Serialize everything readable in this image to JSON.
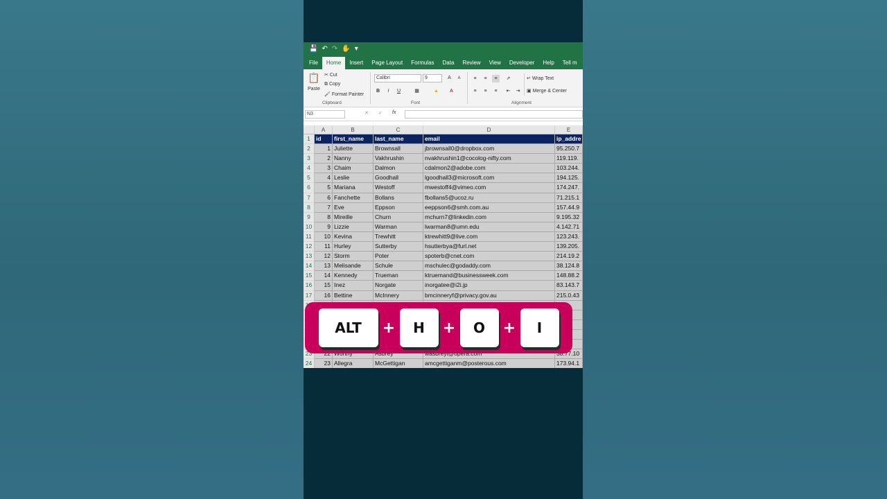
{
  "qat": {
    "save_icon": "save-icon",
    "undo_icon": "undo-icon",
    "redo_icon": "redo-icon",
    "touch_icon": "touch-mode-icon"
  },
  "tabs": [
    "File",
    "Home",
    "Insert",
    "Page Layout",
    "Formulas",
    "Data",
    "Review",
    "View",
    "Developer",
    "Help",
    "Tell m"
  ],
  "active_tab": "Home",
  "ribbon": {
    "clipboard": {
      "paste": "Paste",
      "cut": "Cut",
      "copy": "Copy",
      "format_painter": "Format Painter",
      "label": "Clipboard"
    },
    "font": {
      "name": "Calibri",
      "size": "9",
      "bold": "B",
      "italic": "I",
      "underline": "U",
      "label": "Font",
      "grow": "A",
      "shrink": "A"
    },
    "alignment": {
      "wrap_text": "Wrap Text",
      "merge_center": "Merge & Center",
      "label": "Alignment"
    }
  },
  "formula_bar": {
    "name_box": "N3",
    "fx": "fx",
    "cancel": "✕",
    "enter": "✓",
    "value": ""
  },
  "columns": [
    "A",
    "B",
    "C",
    "D",
    "E"
  ],
  "headers": [
    "id",
    "first_name",
    "last_name",
    "email",
    "ip_addre"
  ],
  "rows": [
    [
      "1",
      "Juliette",
      "Brownsall",
      "jbrownsall0@dropbox.com",
      "95.250.7"
    ],
    [
      "2",
      "Nanny",
      "Vakhrushin",
      "nvakhrushin1@cocolog-nifty.com",
      "119.119."
    ],
    [
      "3",
      "Chaim",
      "Dalmon",
      "cdalmon2@adobe.com",
      "103.244."
    ],
    [
      "4",
      "Leslie",
      "Goodhall",
      "lgoodhall3@microsoft.com",
      "194.125."
    ],
    [
      "5",
      "Mariana",
      "Westoff",
      "mwestoff4@vimeo.com",
      "174.247."
    ],
    [
      "6",
      "Fanchette",
      "Bollans",
      "fbollans5@ucoz.ru",
      "71.215.1"
    ],
    [
      "7",
      "Eve",
      "Eppson",
      "eeppson6@smh.com.au",
      "157.44.9"
    ],
    [
      "8",
      "Mireille",
      "Churn",
      "mchurn7@linkedin.com",
      "9.195.32"
    ],
    [
      "9",
      "Lizzie",
      "Warman",
      "lwarman8@umn.edu",
      "4.142.71"
    ],
    [
      "10",
      "Kevina",
      "Trewhitt",
      "ktrewhitt9@live.com",
      "123.243."
    ],
    [
      "11",
      "Hurley",
      "Sutterby",
      "hsutterbya@furl.net",
      "139.205."
    ],
    [
      "12",
      "Storm",
      "Poter",
      "spoterb@cnet.com",
      "214.19.2"
    ],
    [
      "13",
      "Melisande",
      "Schule",
      "mschulec@godaddy.com",
      "38.124.8"
    ],
    [
      "14",
      "Kennedy",
      "Trueman",
      "ktruemand@businessweek.com",
      "148.88.2"
    ],
    [
      "15",
      "Inez",
      "Norgate",
      "inorgatee@i2i.jp",
      "83.143.7"
    ],
    [
      "16",
      "Bettine",
      "McInnery",
      "bmcinneryf@privacy.gov.au",
      "215.0.43"
    ],
    [
      "",
      "",
      "",
      "",
      "25.1"
    ],
    [
      "",
      "",
      "",
      "",
      "4.22"
    ],
    [
      "",
      "",
      "",
      "",
      "02.1"
    ],
    [
      "",
      "",
      "",
      "",
      "4.2"
    ],
    [
      "",
      "",
      "",
      "",
      "103."
    ],
    [
      "22",
      "Worthy",
      "Asbrey",
      "wasbreyl@opera.com",
      "38.77.10"
    ],
    [
      "23",
      "Allegra",
      "McGettigan",
      "amcgettiganm@posterous.com",
      "173.94.1"
    ]
  ],
  "shortcut": {
    "keys": [
      "ALT",
      "H",
      "O",
      "I"
    ],
    "separator": "+"
  }
}
